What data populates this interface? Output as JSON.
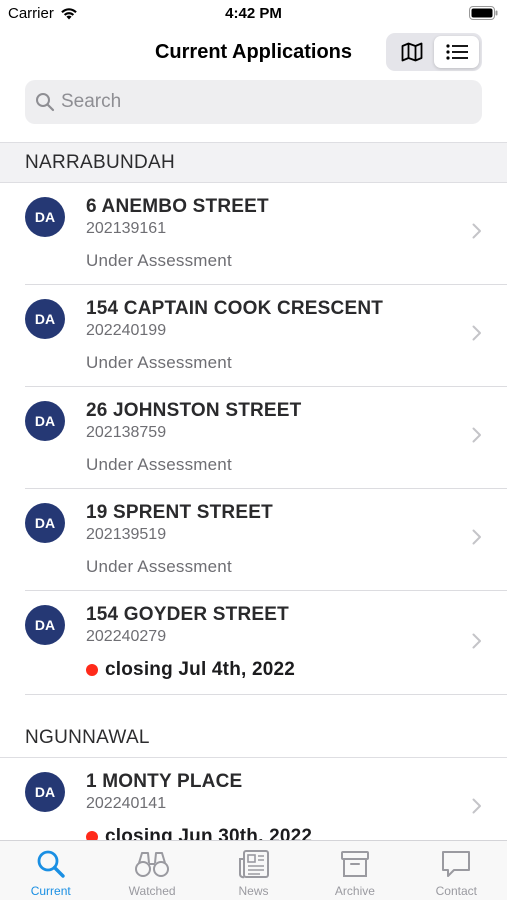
{
  "status_bar": {
    "carrier": "Carrier",
    "time": "4:42 PM"
  },
  "nav": {
    "title": "Current Applications"
  },
  "search": {
    "placeholder": "Search"
  },
  "sections": [
    {
      "header": "NARRABUNDAH",
      "rows": [
        {
          "badge": "DA",
          "title": "6 ANEMBO STREET",
          "number": "202139161",
          "status": "Under Assessment"
        },
        {
          "badge": "DA",
          "title": "154 CAPTAIN COOK CRESCENT",
          "number": "202240199",
          "status": "Under Assessment"
        },
        {
          "badge": "DA",
          "title": "26 JOHNSTON STREET",
          "number": "202138759",
          "status": "Under Assessment"
        },
        {
          "badge": "DA",
          "title": "19 SPRENT STREET",
          "number": "202139519",
          "status": "Under Assessment"
        },
        {
          "badge": "DA",
          "title": "154 GOYDER STREET",
          "number": "202240279",
          "status": "closing Jul 4th, 2022"
        }
      ]
    },
    {
      "header": "NGUNNAWAL",
      "rows": [
        {
          "badge": "DA",
          "title": "1 MONTY PLACE",
          "number": "202240141",
          "status": "closing Jun 30th, 2022"
        }
      ]
    }
  ],
  "tabs": [
    {
      "label": "Current",
      "icon": "magnifier-icon"
    },
    {
      "label": "Watched",
      "icon": "binoculars-icon"
    },
    {
      "label": "News",
      "icon": "newspaper-icon"
    },
    {
      "label": "Archive",
      "icon": "archive-box-icon"
    },
    {
      "label": "Contact",
      "icon": "chat-bubble-icon"
    }
  ],
  "colors": {
    "badge": "#253874",
    "accent": "#1a8fe3",
    "closing_dot": "#ff2a1a"
  }
}
